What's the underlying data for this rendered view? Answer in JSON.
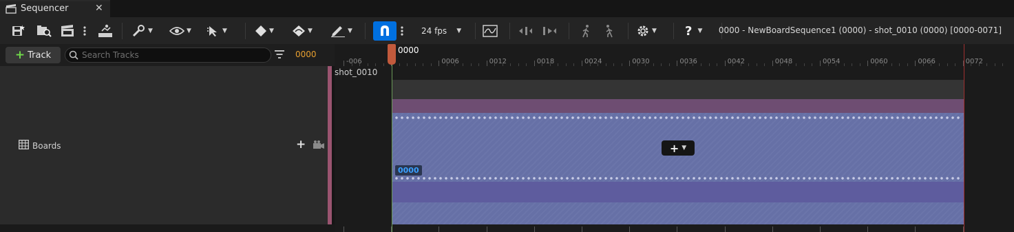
{
  "tab": {
    "title": "Sequencer",
    "close": "✕"
  },
  "toolbar": {
    "fps_label": "24 fps",
    "sequence_info": "0000 - NewBoardSequence1 (0000) - shot_0010 (0000) [0000-0071]"
  },
  "left": {
    "track_button_label": "Track",
    "search_placeholder": "Search Tracks",
    "current_frame": "0000",
    "track_name": "Boards"
  },
  "timeline": {
    "playhead_frame": "0000",
    "shot_name": "shot_0010",
    "section_frame_badge": "0000",
    "ruler_labels": [
      "-006",
      "0000",
      "0006",
      "0012",
      "0018",
      "0024",
      "0030",
      "0036",
      "0042",
      "0048",
      "0054",
      "0060",
      "0066",
      "0072"
    ]
  },
  "colors": {
    "accent_blue": "#0070e0",
    "playhead": "#c25a3c",
    "frame_orange": "#e8a030",
    "shot_section": "#6670a6",
    "track_stripe": "#9a5470"
  }
}
